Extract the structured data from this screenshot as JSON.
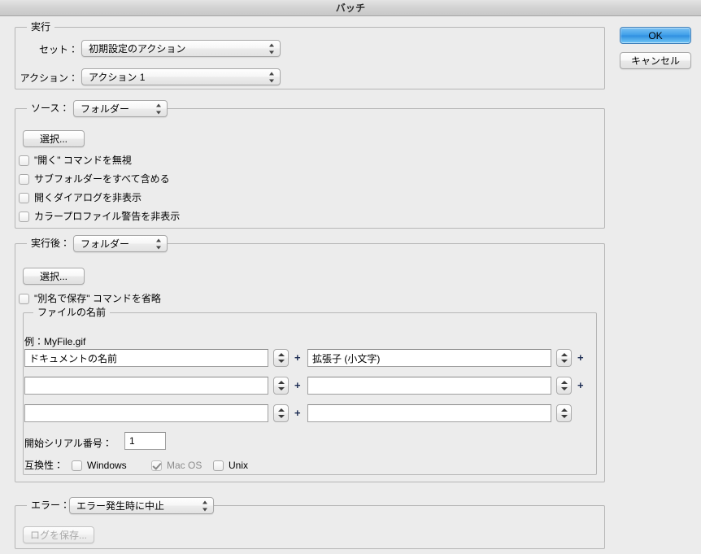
{
  "window": {
    "title": "バッチ"
  },
  "buttons": {
    "ok": "OK",
    "cancel": "キャンセル"
  },
  "play": {
    "legend": "実行",
    "set_label": "セット：",
    "set_value": "初期設定のアクション",
    "action_label": "アクション：",
    "action_value": "アクション 1"
  },
  "source": {
    "legend": "ソース：",
    "value": "フォルダー",
    "choose_button": "選択...",
    "checkboxes": [
      {
        "label": "\"開く\" コマンドを無視",
        "checked": false
      },
      {
        "label": "サブフォルダーをすべて含める",
        "checked": false
      },
      {
        "label": "開くダイアログを非表示",
        "checked": false
      },
      {
        "label": "カラープロファイル警告を非表示",
        "checked": false
      }
    ]
  },
  "destination": {
    "legend": "実行後：",
    "value": "フォルダー",
    "choose_button": "選択...",
    "override_checkbox": {
      "label": "\"別名で保存\" コマンドを省略",
      "checked": false
    },
    "filenaming": {
      "legend": "ファイルの名前",
      "example": "例：MyFile.gif",
      "rows": [
        {
          "left": "ドキュメントの名前",
          "right": "拡張子 (小文字)",
          "trailing_plus": true
        },
        {
          "left": "",
          "right": "",
          "trailing_plus": true
        },
        {
          "left": "",
          "right": "",
          "trailing_plus": false
        }
      ],
      "plus_separator": "+",
      "serial_label": "開始シリアル番号：",
      "serial_value": "1",
      "compat_label": "互換性：",
      "compat": [
        {
          "label": "Windows",
          "checked": false,
          "disabled": false
        },
        {
          "label": "Mac OS",
          "checked": true,
          "disabled": true
        },
        {
          "label": "Unix",
          "checked": false,
          "disabled": false
        }
      ]
    }
  },
  "errors": {
    "legend": "エラー：",
    "value": "エラー発生時に中止",
    "save_log_button": "ログを保存..."
  },
  "icons": {
    "popup_arrows": "popup-arrows-icon",
    "stepper_arrows": "stepper-arrows-icon",
    "checkmark": "checkmark-icon"
  },
  "colors": {
    "window_background": "#ececec",
    "default_button_accent": "#3f9fe9",
    "group_border": "#b6b6b6"
  }
}
